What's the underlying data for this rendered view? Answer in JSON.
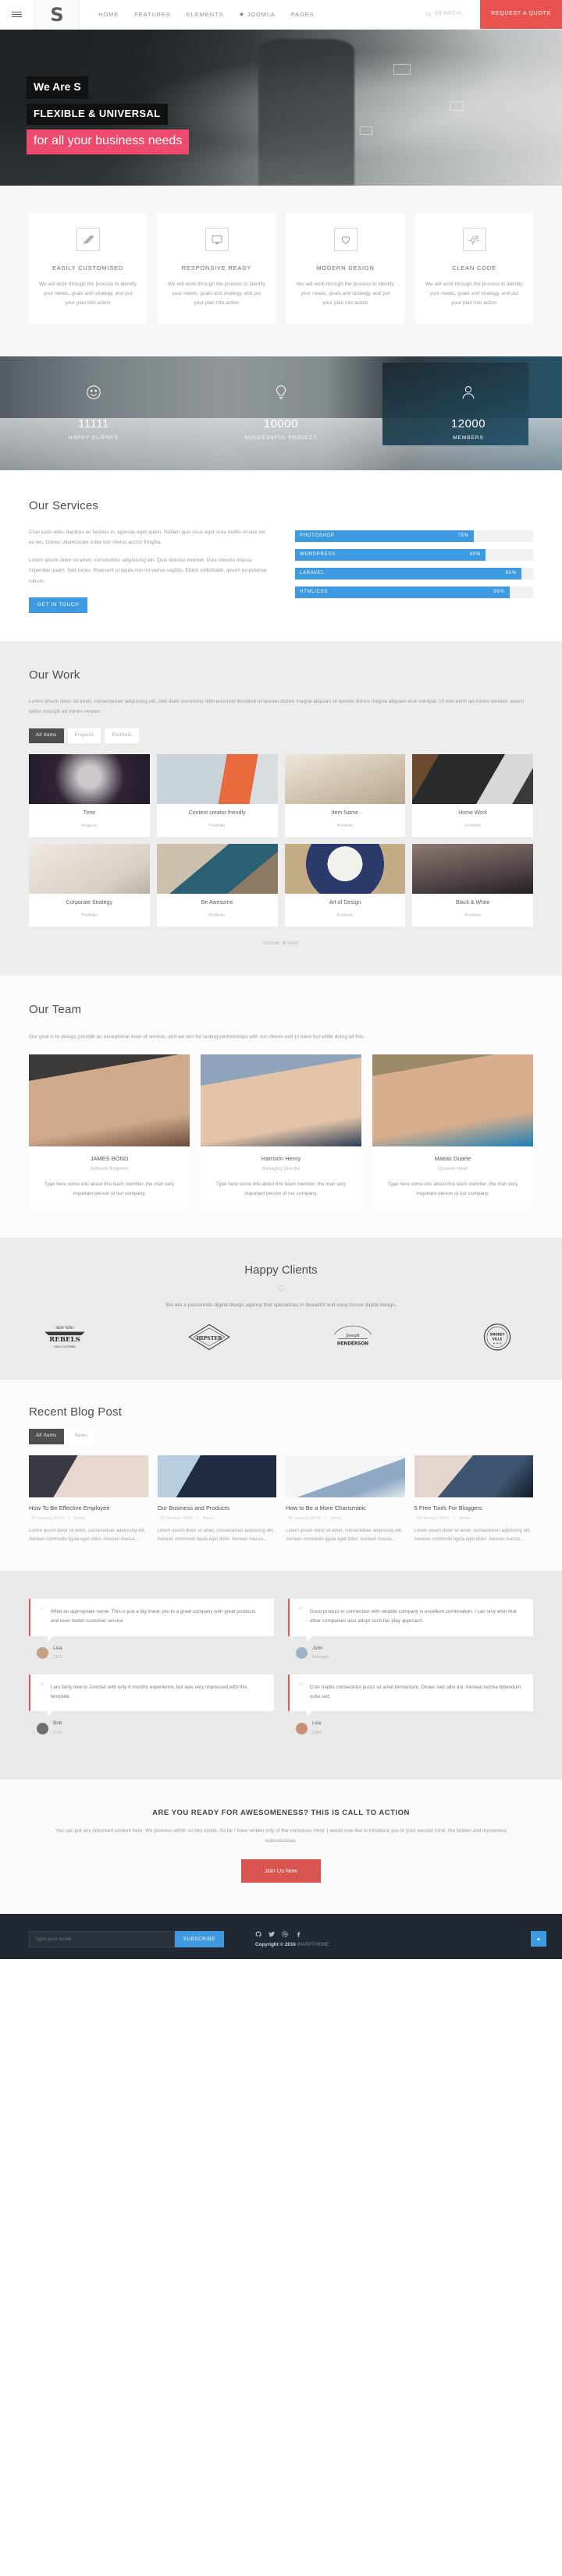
{
  "header": {
    "logo_text": "S",
    "nav": [
      {
        "label": "HOME"
      },
      {
        "label": "FEATURES"
      },
      {
        "label": "ELEMENTS"
      },
      {
        "label": "JOOMLA"
      },
      {
        "label": "PAGES"
      }
    ],
    "search_label": "SEARCH...",
    "quote_label": "REQUEST A QUOTE"
  },
  "hero": {
    "line1": "We Are S",
    "line2": "FLEXIBLE & UNIVERSAL",
    "line3": "for all your business needs",
    "accent": "#ee4a6d"
  },
  "features": {
    "cards": [
      {
        "icon": "pencils-icon",
        "title": "EASILY CUSTOMISED",
        "text": "We will work through the process to identify your needs, goals and strategy, and put your plan into action"
      },
      {
        "icon": "monitor-icon",
        "title": "RESPONSIVE READY",
        "text": "We will work through the process to identify your needs, goals and strategy, and put your plan into action"
      },
      {
        "icon": "heart-icon",
        "title": "MODERN DESIGN",
        "text": "We will work through the process to identify your needs, goals and strategy, and put your plan into action"
      },
      {
        "icon": "gears-icon",
        "title": "CLEAN CODE",
        "text": "We will work through the process to identify your needs, goals and strategy, and put your plan into action"
      }
    ]
  },
  "counters": {
    "items": [
      {
        "icon": "smiley-icon",
        "value": "11111",
        "label": "HAPPY CLIENTS"
      },
      {
        "icon": "bulb-icon",
        "value": "10000",
        "label": "SUCCESSFUL PROJECT"
      },
      {
        "icon": "user-icon",
        "value": "12000",
        "label": "MEMBERS"
      }
    ]
  },
  "services": {
    "title": "Our Services",
    "p1": "Cras justo odio, dapibus ac facilisis in, egestas eget quam. Nullam quis risus eget urna mollis ornare vel eu leo. Donec ullamcorper nulla non metus auctor fringilla.",
    "p2": "Lorem ipsum dolor sit amet, consectetur adipisicing elit. Quis dolores eveniet. Duis lobortis massa imperdiet quam. Sed turpis. Praesent ut ligula non mi varius sagittis. Etiam sollicitudin, ipsum eu pulvinar rutrum.",
    "button": "GET IN TOUCH",
    "bar_color": "#3d99e0",
    "skills": [
      {
        "label": "PHOTOSHOP",
        "value": 75,
        "display": "75%"
      },
      {
        "label": "WORDPRESS",
        "value": 80,
        "display": "80%"
      },
      {
        "label": "LARAVEL",
        "value": 95,
        "display": "95%"
      },
      {
        "label": "HTML/CSS",
        "value": 90,
        "display": "90%"
      }
    ]
  },
  "work": {
    "title": "Our Work",
    "lead": "Lorem ipsum dolor sit amet, consectetuer adipiscing elit, sed diam nonummy nibh euismod tincidunt ut laoreet dolore magna aliquam ut laoreet dolore magna aliquam erat volutpat. Ut wisi enim ad minim veniam, exerci tation suscipit ad minim veniam.",
    "filters": [
      {
        "label": "All Items",
        "active": true
      },
      {
        "label": "Projects",
        "active": false
      },
      {
        "label": "Portfolio",
        "active": false
      }
    ],
    "items": [
      {
        "title": "Time",
        "category": "Projects"
      },
      {
        "title": "Content creator friendly",
        "category": "Portfolio"
      },
      {
        "title": "Item Name",
        "category": "Portfolio"
      },
      {
        "title": "Home Work",
        "category": "Portfolio"
      },
      {
        "title": "Corporate Strategy",
        "category": "Portfolio"
      },
      {
        "title": "Be Awesome",
        "category": "Portfolio"
      },
      {
        "title": "Art of Design",
        "category": "Portfolio"
      },
      {
        "title": "Black & White",
        "category": "Portfolio"
      }
    ],
    "show_more": "SHOW MORE"
  },
  "team": {
    "title": "Our Team",
    "lead": "Our goal is to always provide an exceptional level of service, and we aim for lasting partnerships with our clients and to have fun while doing all this.",
    "members": [
      {
        "name": "JAMES BOND",
        "role": "Software Engineer",
        "bio": "Type here some info about this team member, the man very important person of our company."
      },
      {
        "name": "Harrison Henry",
        "role": "Managing Director",
        "bio": "Type here some info about this team member, the man very important person of our company."
      },
      {
        "name": "Matias Duarte",
        "role": "Creative Head",
        "bio": "Type here some info about this team member, the man very important person of our company."
      }
    ]
  },
  "clients": {
    "title": "Happy Clients",
    "lead": "We are a passionate digital design agency that specializes in beautiful and easy-to-use digital design.",
    "logos": [
      {
        "name": "REBELS",
        "sub": "NEW YORK",
        "foot": "HIGH CLOTHING"
      },
      {
        "name": "HIPSTER",
        "sub": "",
        "foot": ""
      },
      {
        "name": "Joseph",
        "sub": "HENDERSON",
        "foot": ""
      },
      {
        "name": "SMOKEYVILLE",
        "sub": "",
        "foot": ""
      }
    ]
  },
  "blog": {
    "title": "Recent Blog Post",
    "filters": [
      {
        "label": "All Items",
        "active": true
      },
      {
        "label": "News",
        "active": false
      }
    ],
    "posts": [
      {
        "title": "How To Be Effective Employee",
        "date": "29 January 2016",
        "category": "News",
        "excerpt": "Lorem ipsum dolor sit amet, consectetuer adipiscing elit, Aenean commodo ligula eget dolor. Aenean massa..."
      },
      {
        "title": "Our Business and Products",
        "date": "29 January 2016",
        "category": "News",
        "excerpt": "Lorem ipsum dolor sit amet, consectetuer adipiscing elit, Aenean commodo ligula eget dolor. Aenean massa..."
      },
      {
        "title": "How to Be a More Charismatic",
        "date": "29 January 2016",
        "category": "News",
        "excerpt": "Lorem ipsum dolor sit amet, consectetuer adipiscing elit, Aenean commodo ligula eget dolor. Aenean massa..."
      },
      {
        "title": "5 Free Tools For Bloggers",
        "date": "29 January 2016",
        "category": "News",
        "excerpt": "Lorem ipsum dolor sit amet, consectetuer adipiscing elit, Aenean commodo ligula eget dolor. Aenean massa..."
      }
    ]
  },
  "testimonials": {
    "items": [
      {
        "quote": "What an appropriate name. This is just a big thank you to a great company with great products and even better customer service",
        "name": "Lisa",
        "role": "CEO"
      },
      {
        "quote": "Good product in connection with reliable company is excellent combination. I can only wish that other companies also adopt such fair play approach.",
        "name": "John",
        "role": "Manager"
      },
      {
        "quote": "I am fairly new to Joomla! with only 6 months experience, but was very impressed with this template.",
        "name": "Bob",
        "role": "CTO"
      },
      {
        "quote": "Cras mattis consectetur purus sit amet fermentum. Donec sed odio dui. Aenean lacinia bibendum nulla sed.",
        "name": "Lisa",
        "role": "CMO"
      }
    ],
    "accent": "#e8534f"
  },
  "cta": {
    "title": "ARE YOU READY FOR AWESOMENESS? THIS IS CALL TO ACTION",
    "text": "You can put any important content here. We possess within us two minds. So far I have written only of the conscious mind. I would now like to introduce you to your second mind, the hidden and mysterious subconscious.",
    "button": "Join Us Now",
    "button_color": "#d9534f"
  },
  "footer": {
    "email_placeholder": "Type your email",
    "email_value": "",
    "subscribe_label": "SUBSCRIBE",
    "social": [
      "github-icon",
      "twitter-icon",
      "dribbble-icon",
      "facebook-icon"
    ],
    "copyright_prefix": "Copyright © 2016",
    "copyright_brand": "WARPTHEME",
    "to_top": "scroll-to-top"
  }
}
